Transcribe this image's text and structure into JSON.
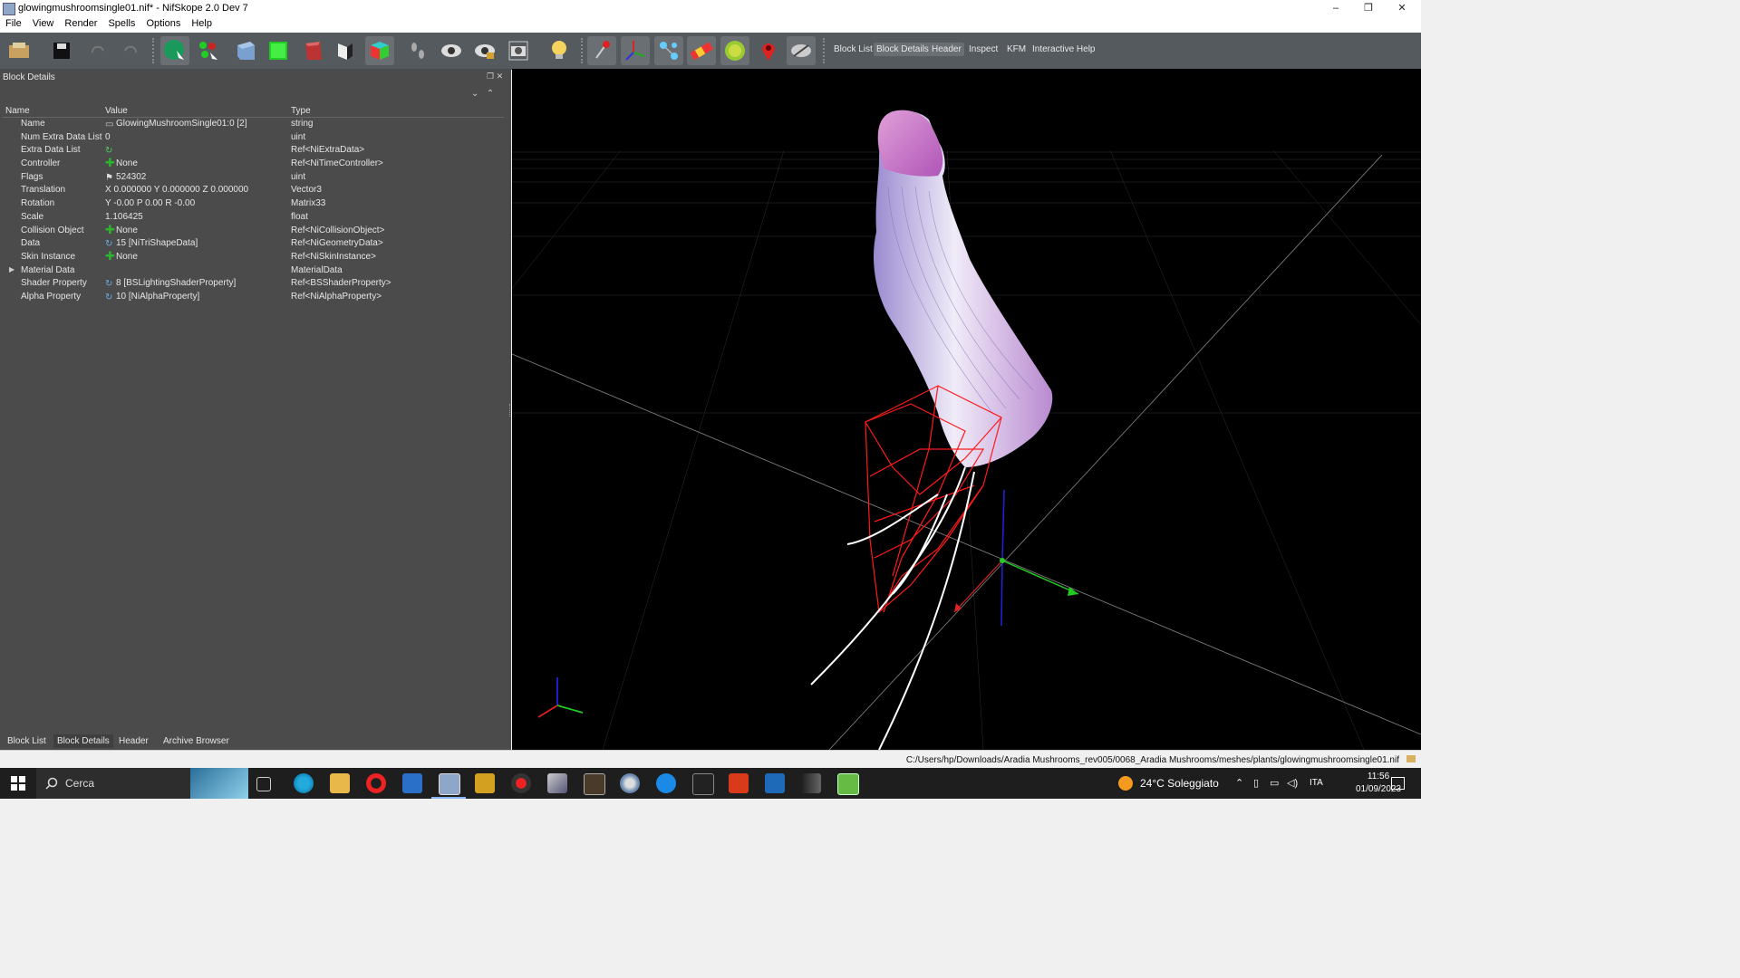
{
  "window": {
    "title": "glowingmushroomsingle01.nif* - NifSkope 2.0 Dev 7",
    "minimize": "–",
    "restore": "❐",
    "close": "✕"
  },
  "menu": [
    "File",
    "View",
    "Render",
    "Spells",
    "Options",
    "Help"
  ],
  "toolbar": {
    "text_buttons": [
      "Block List",
      "Block Details",
      "Header",
      "Inspect",
      "KFM",
      "Interactive Help"
    ]
  },
  "panel": {
    "title": "Block Details",
    "headers": {
      "name": "Name",
      "value": "Value",
      "type": "Type"
    },
    "rows": [
      {
        "name": "Name",
        "value": "GlowingMushroomSingle01:0 [2]",
        "type": "string",
        "icon": "text-icon"
      },
      {
        "name": "Num Extra Data List",
        "value": "0",
        "type": "uint",
        "icon": ""
      },
      {
        "name": "Extra Data List",
        "value": "",
        "type": "Ref<NiExtraData>",
        "icon": "refresh-icon"
      },
      {
        "name": "Controller",
        "value": "None",
        "type": "Ref<NiTimeController>",
        "icon": "plus-icon"
      },
      {
        "name": "Flags",
        "value": "524302",
        "type": "uint",
        "icon": "flag-icon"
      },
      {
        "name": "Translation",
        "value": "X 0.000000 Y 0.000000 Z 0.000000",
        "type": "Vector3",
        "icon": ""
      },
      {
        "name": "Rotation",
        "value": "Y -0.00 P 0.00 R -0.00",
        "type": "Matrix33",
        "icon": ""
      },
      {
        "name": "Scale",
        "value": "1.106425",
        "type": "float",
        "icon": ""
      },
      {
        "name": "Collision Object",
        "value": "None",
        "type": "Ref<NiCollisionObject>",
        "icon": "plus-icon"
      },
      {
        "name": "Data",
        "value": "15 [NiTriShapeData]",
        "type": "Ref<NiGeometryData>",
        "icon": "link-icon"
      },
      {
        "name": "Skin Instance",
        "value": "None",
        "type": "Ref<NiSkinInstance>",
        "icon": "plus-icon"
      },
      {
        "name": "Material Data",
        "value": "",
        "type": "MaterialData",
        "icon": ""
      },
      {
        "name": "Shader Property",
        "value": "8 [BSLightingShaderProperty]",
        "type": "Ref<BSShaderProperty>",
        "icon": "link-icon"
      },
      {
        "name": "Alpha Property",
        "value": "10 [NiAlphaProperty]",
        "type": "Ref<NiAlphaProperty>",
        "icon": "link-icon"
      }
    ],
    "tabs": [
      "Block List",
      "Block Details",
      "Header",
      "Archive Browser"
    ]
  },
  "status": {
    "path": "C:/Users/hp/Downloads/Aradia Mushrooms_rev005/0068_Aradia Mushrooms/meshes/plants/glowingmushroomsingle01.nif"
  },
  "taskbar": {
    "search_label": "Cerca",
    "weather": "24°C  Soleggiato",
    "lang": "ITA",
    "time": "11:56",
    "date": "01/09/2023"
  },
  "colors": {
    "panel_bg": "#4b4b4b",
    "toolbar_bg": "#555a5e",
    "viewport_bg": "#000000",
    "taskbar_bg": "#1e1e1e"
  }
}
